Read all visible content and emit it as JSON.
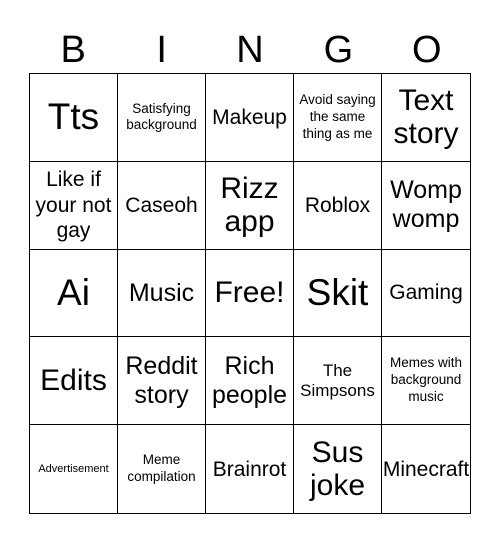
{
  "title_letters": [
    "B",
    "I",
    "N",
    "G",
    "O"
  ],
  "cells": [
    {
      "text": "Tts",
      "size": "s-xl"
    },
    {
      "text": "Satisfying background",
      "size": "s-xs"
    },
    {
      "text": "Makeup",
      "size": "s-m"
    },
    {
      "text": "Avoid saying the same thing as me",
      "size": "s-xs"
    },
    {
      "text": "Text story",
      "size": "s-l"
    },
    {
      "text": "Like if your not gay",
      "size": "s-m"
    },
    {
      "text": "Caseoh",
      "size": "s-m"
    },
    {
      "text": "Rizz app",
      "size": "s-l"
    },
    {
      "text": "Roblox",
      "size": "s-m"
    },
    {
      "text": "Womp womp",
      "size": "s-ml"
    },
    {
      "text": "Ai",
      "size": "s-xl"
    },
    {
      "text": "Music",
      "size": "s-ml"
    },
    {
      "text": "Free!",
      "size": "s-l"
    },
    {
      "text": "Skit",
      "size": "s-xl"
    },
    {
      "text": "Gaming",
      "size": "s-m"
    },
    {
      "text": "Edits",
      "size": "s-l"
    },
    {
      "text": "Reddit story",
      "size": "s-ml"
    },
    {
      "text": "Rich people",
      "size": "s-ml"
    },
    {
      "text": "The Simpsons",
      "size": "s-s"
    },
    {
      "text": "Memes with background music",
      "size": "s-xs"
    },
    {
      "text": "Advertisement",
      "size": "s-xxs"
    },
    {
      "text": "Meme compilation",
      "size": "s-xs"
    },
    {
      "text": "Brainrot",
      "size": "s-m"
    },
    {
      "text": "Sus joke",
      "size": "s-l"
    },
    {
      "text": "Minecraft",
      "size": "s-m"
    }
  ]
}
